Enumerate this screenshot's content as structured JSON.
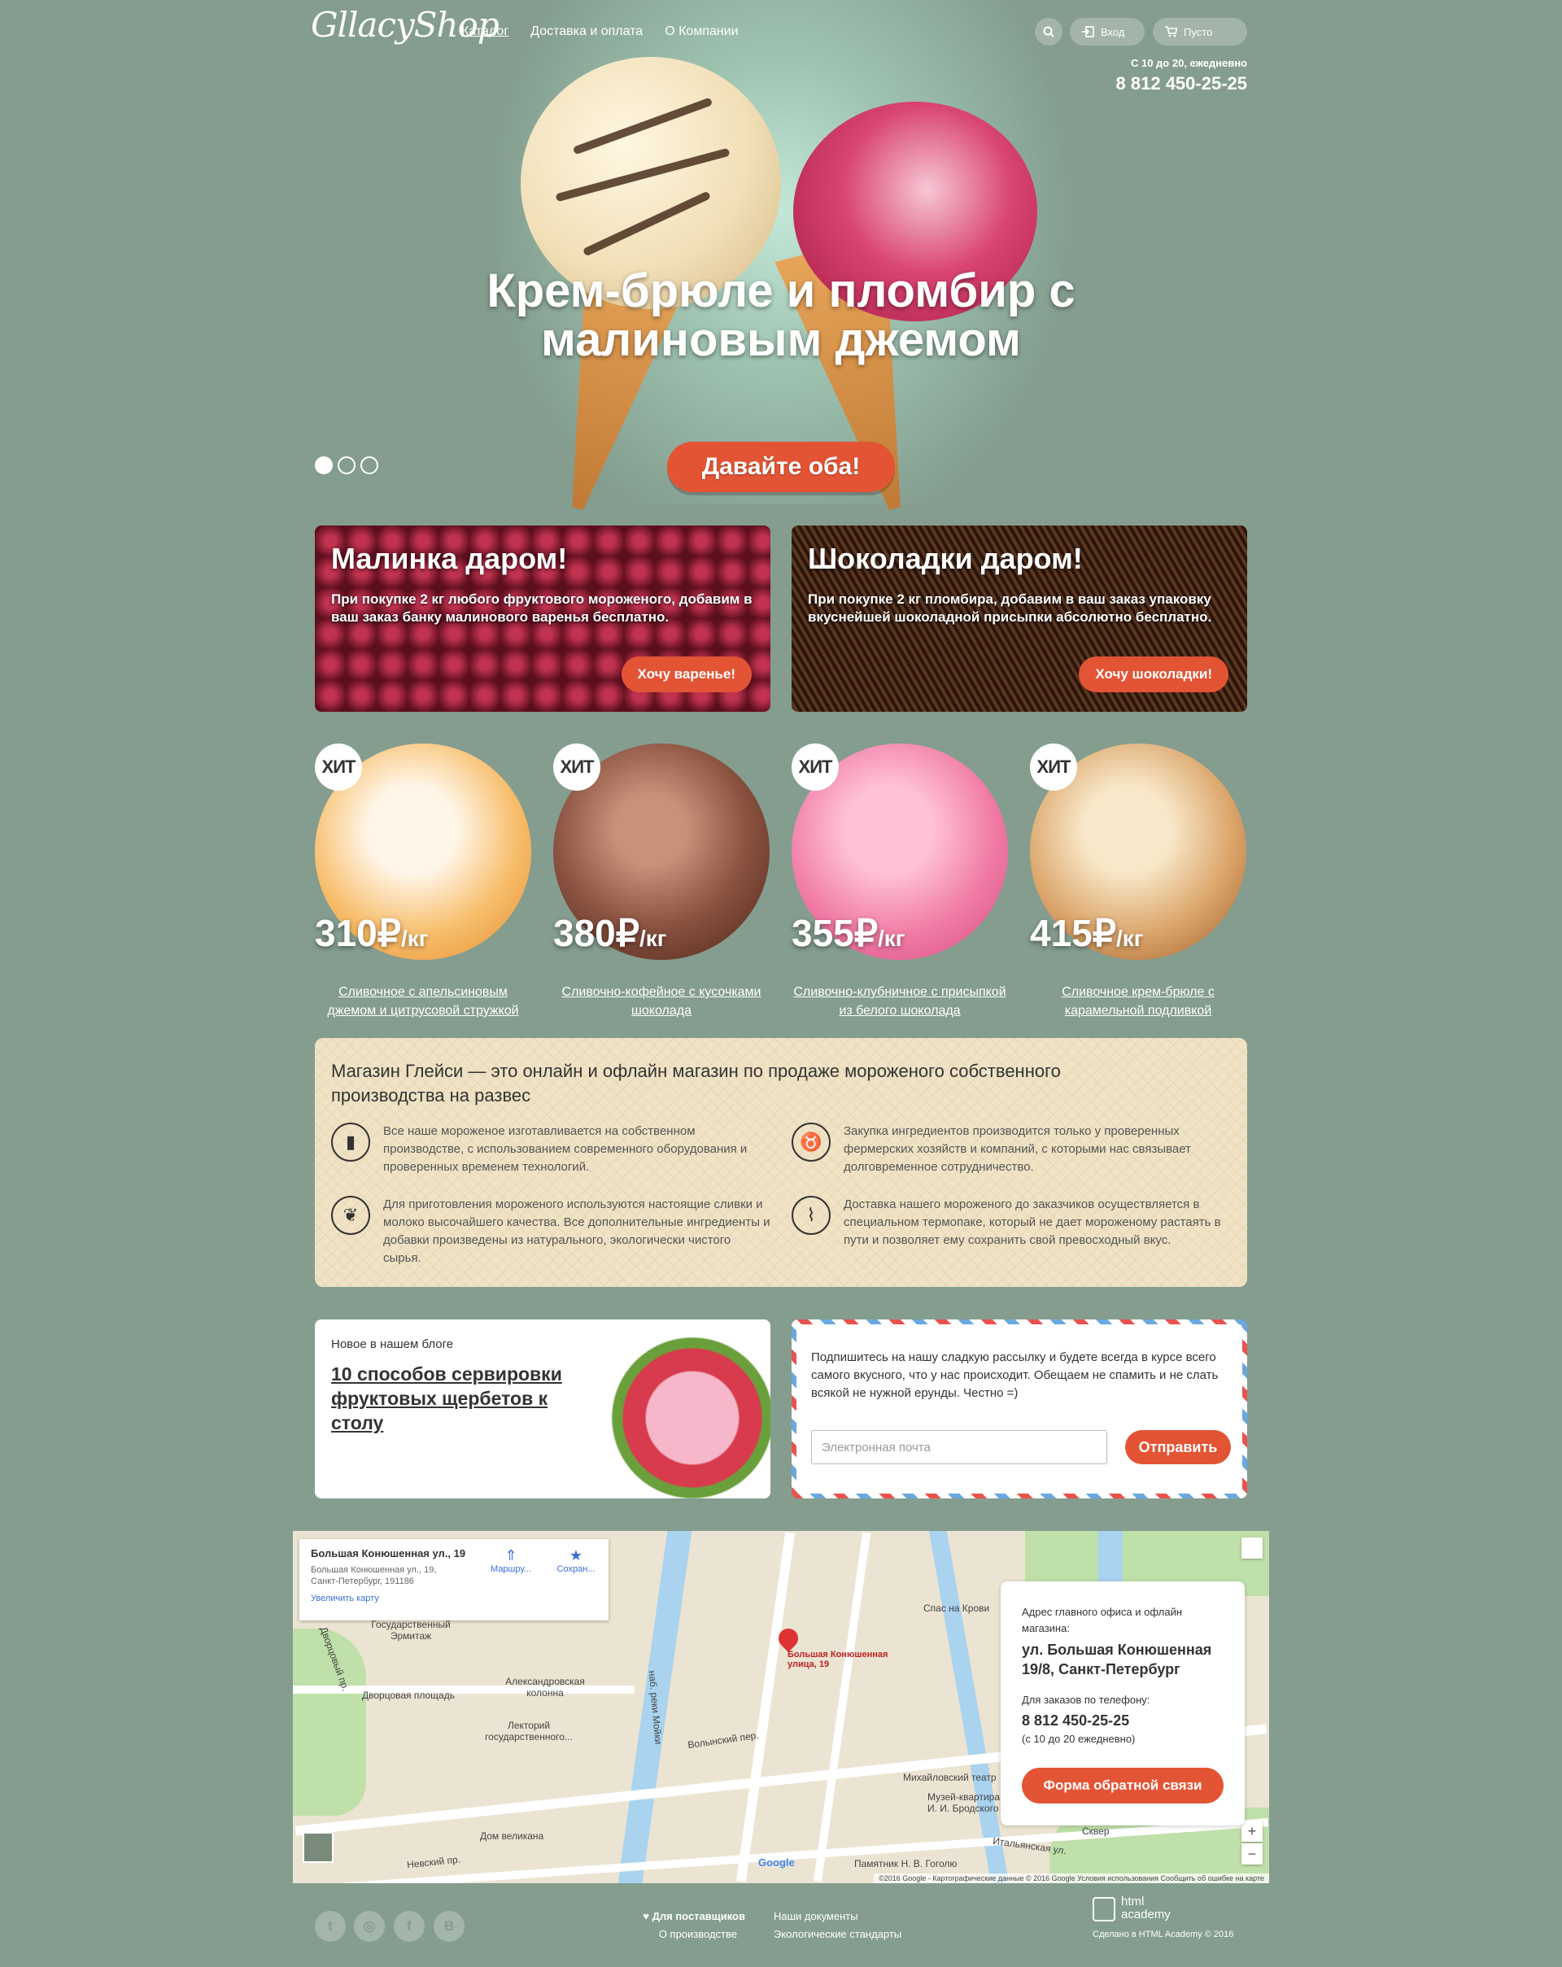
{
  "header": {
    "logo": "GllacyShop",
    "nav": [
      "Каталог",
      "Доставка и оплата",
      "О Компании"
    ],
    "login": "Вход",
    "cart": "Пусто",
    "hours": "С 10 до 20, ежедневно",
    "phone": "8 812 450-25-25"
  },
  "hero": {
    "title": "Крем-брюле и пломбир с малиновым джемом",
    "button": "Давайте оба!",
    "slides_total": 3,
    "slide_active": 1
  },
  "promos": [
    {
      "title": "Малинка даром!",
      "text": "При покупке 2 кг любого фруктового мороженого, добавим в ваш заказ банку малинового варенья бесплатно.",
      "button": "Хочу варенье!"
    },
    {
      "title": "Шоколадки даром!",
      "text": "При покупке 2 кг пломбира, добавим в ваш заказ упаковку вкуснейшей шоколадной присыпки абсолютно бесплатно.",
      "button": "Хочу шоколадки!"
    }
  ],
  "products": [
    {
      "badge": "ХИТ",
      "price": "310₽",
      "unit": "/кг",
      "name": "Сливочное с апельсиновым джемом и цитрусовой стружкой",
      "color": "#f2a64a"
    },
    {
      "badge": "ХИТ",
      "price": "380₽",
      "unit": "/кг",
      "name": "Сливочно-кофейное с кусочками шоколада",
      "color": "#7a4430"
    },
    {
      "badge": "ХИТ",
      "price": "355₽",
      "unit": "/кг",
      "name": "Сливочно-клубничное с присыпкой из белого шоколада",
      "color": "#ef6f9c"
    },
    {
      "badge": "ХИТ",
      "price": "415₽",
      "unit": "/кг",
      "name": "Сливочное крем-брюле с карамельной подливкой",
      "color": "#d79a58"
    }
  ],
  "about": {
    "heading": "Магазин Глейси  — это онлайн и офлайн магазин по продаже мороженого собственного производства на развес",
    "features": [
      {
        "icon": "popsicle-icon",
        "text": "Все наше мороженое изготавливается на собственном производстве, с использованием современного оборудования и проверенных временем технологий."
      },
      {
        "icon": "cow-icon",
        "text": "Закупка ингредиентов производится только у проверенных фермерских хозяйств и компаний, с которыми нас связывает долговременное сотрудничество."
      },
      {
        "icon": "leaf-icon",
        "text": "Для приготовления мороженого используются настоящие сливки и молоко высочайшего качества. Все дополнительные ингредиенты и добавки произведены из натурального, экологически чистого сырья."
      },
      {
        "icon": "thermometer-icon",
        "text": "Доставка нашего мороженого до заказчиков осуществляется в специальном термопаке, который не дает мороженому растаять в пути и позволяет ему сохранить свой превосходный вкус."
      }
    ]
  },
  "blog": {
    "label": "Новое в нашем блоге",
    "title": "10  способов сервировки фруктовых щербетов к столу"
  },
  "subscribe": {
    "text": "Подпишитесь на нашу сладкую рассылку и будете всегда в курсе всего самого вкусного, что у нас происходит. Обещаем не спамить и не слать всякой не нужной ерунды. Честно =)",
    "placeholder": "Электронная почта",
    "button": "Отправить"
  },
  "map": {
    "info_title": "Большая Конюшенная ул., 19",
    "info_address": "Большая Конюшенная ул., 19, Санкт-Петербург, 191186",
    "info_link": "Увеличить карту",
    "route": "Маршру...",
    "save": "Сохран...",
    "pin_label": "Большая Конюшенная улица, 19",
    "labels": [
      "Государственный Эрмитаж",
      "Дворцовая площадь",
      "Александровская колонна",
      "Лекторий государственного...",
      "Волынский пер.",
      "наб. реки Мойки",
      "Спас на Крови",
      "Михайловский театр",
      "Музей-квартира И. И. Бродского",
      "Дом великана",
      "Невский пр.",
      "Итальянская ул.",
      "Памятник Н. В. Гоголю",
      "Сквер",
      "Дворцовый пр."
    ],
    "copyright": "©2016 Google - Картографические данные © 2016 Google    Условия использования    Сообщить об ошибке на карте",
    "google": "Google"
  },
  "contact": {
    "address_label": "Адрес главного офиса и офлайн магазина:",
    "address": "ул. Большая Конюшенная 19/8, Санкт-Петербург",
    "phone_label": "Для заказов по телефону:",
    "phone": "8 812 450-25-25",
    "hours": "(с 10 до 20 ежедневно)",
    "button": "Форма обратной связи"
  },
  "footer": {
    "social": [
      "twitter-icon",
      "instagram-icon",
      "facebook-icon",
      "vk-icon"
    ],
    "links_col1": [
      "Для поставщиков",
      "О производстве"
    ],
    "links_col2": [
      "Наши документы",
      "Экологические стандарты"
    ],
    "academy_logo": "html academy",
    "credit": "Сделано в HTML Academy © 2016"
  },
  "colors": {
    "accent": "#e35435",
    "background": "#849d8f",
    "about_bg": "#efe2c5"
  }
}
